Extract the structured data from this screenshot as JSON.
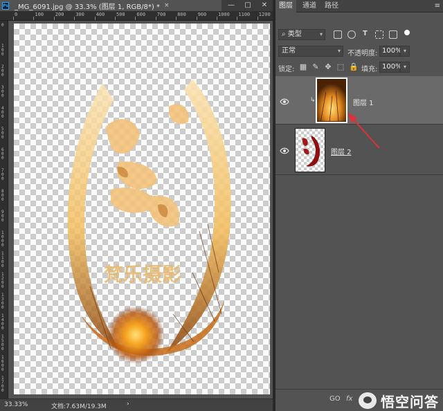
{
  "document": {
    "tab_title": "_MG_6091.jpg @ 33.3% (图层 1, RGB/8*) *",
    "tab_close": "×",
    "window_controls": [
      "—",
      "□",
      "✕"
    ],
    "ps_icon": "Ps"
  },
  "ruler": {
    "top_labels": [
      "0",
      "100",
      "200",
      "300",
      "400",
      "500",
      "600",
      "700",
      "800",
      "900",
      "1000",
      "1100",
      "1200"
    ],
    "left_labels": [
      "0",
      "1 0 0",
      "2 0 0",
      "3 0 0",
      "4 0 0",
      "5 0 0",
      "6 0 0",
      "7 0 0",
      "8 0 0",
      "9 0 0",
      "1 0 0 0",
      "1 1 0 0",
      "1 2 0 0",
      "1 3 0 0",
      "1 4 0 0",
      "1 5 0 0",
      "1 6 0 0",
      "1 7 0 0"
    ]
  },
  "canvas": {
    "artwork_text": "梵乐摄影"
  },
  "status": {
    "zoom": "33.33%",
    "doc_size": "文档:7.63M/19.3M",
    "arrow": "›"
  },
  "panel": {
    "tabs": [
      "图层",
      "通道",
      "路径"
    ],
    "menu_icon": "≡",
    "filter_kind": "类型",
    "filter_icons": [
      "image-filter-icon",
      "adjustment-filter-icon",
      "type-filter-icon",
      "shape-filter-icon",
      "smart-object-filter-icon",
      "filter-toggle-icon"
    ],
    "blend_mode": "正常",
    "opacity_label": "不透明度:",
    "opacity_value": "100%",
    "lock_label": "锁定:",
    "fill_label": "填充:",
    "fill_value": "100%",
    "layers": [
      {
        "name": "图层 1",
        "selected": true,
        "clipped": true
      },
      {
        "name": "图层 2",
        "selected": false,
        "clipped": false
      }
    ],
    "footer_link": "GO",
    "footer_fx": "fx"
  },
  "watermark": {
    "text": "悟空问答"
  },
  "colors": {
    "accent_arrow": "#e0303a",
    "panel_bg": "#535353",
    "selected_row": "#6a6a6a"
  }
}
